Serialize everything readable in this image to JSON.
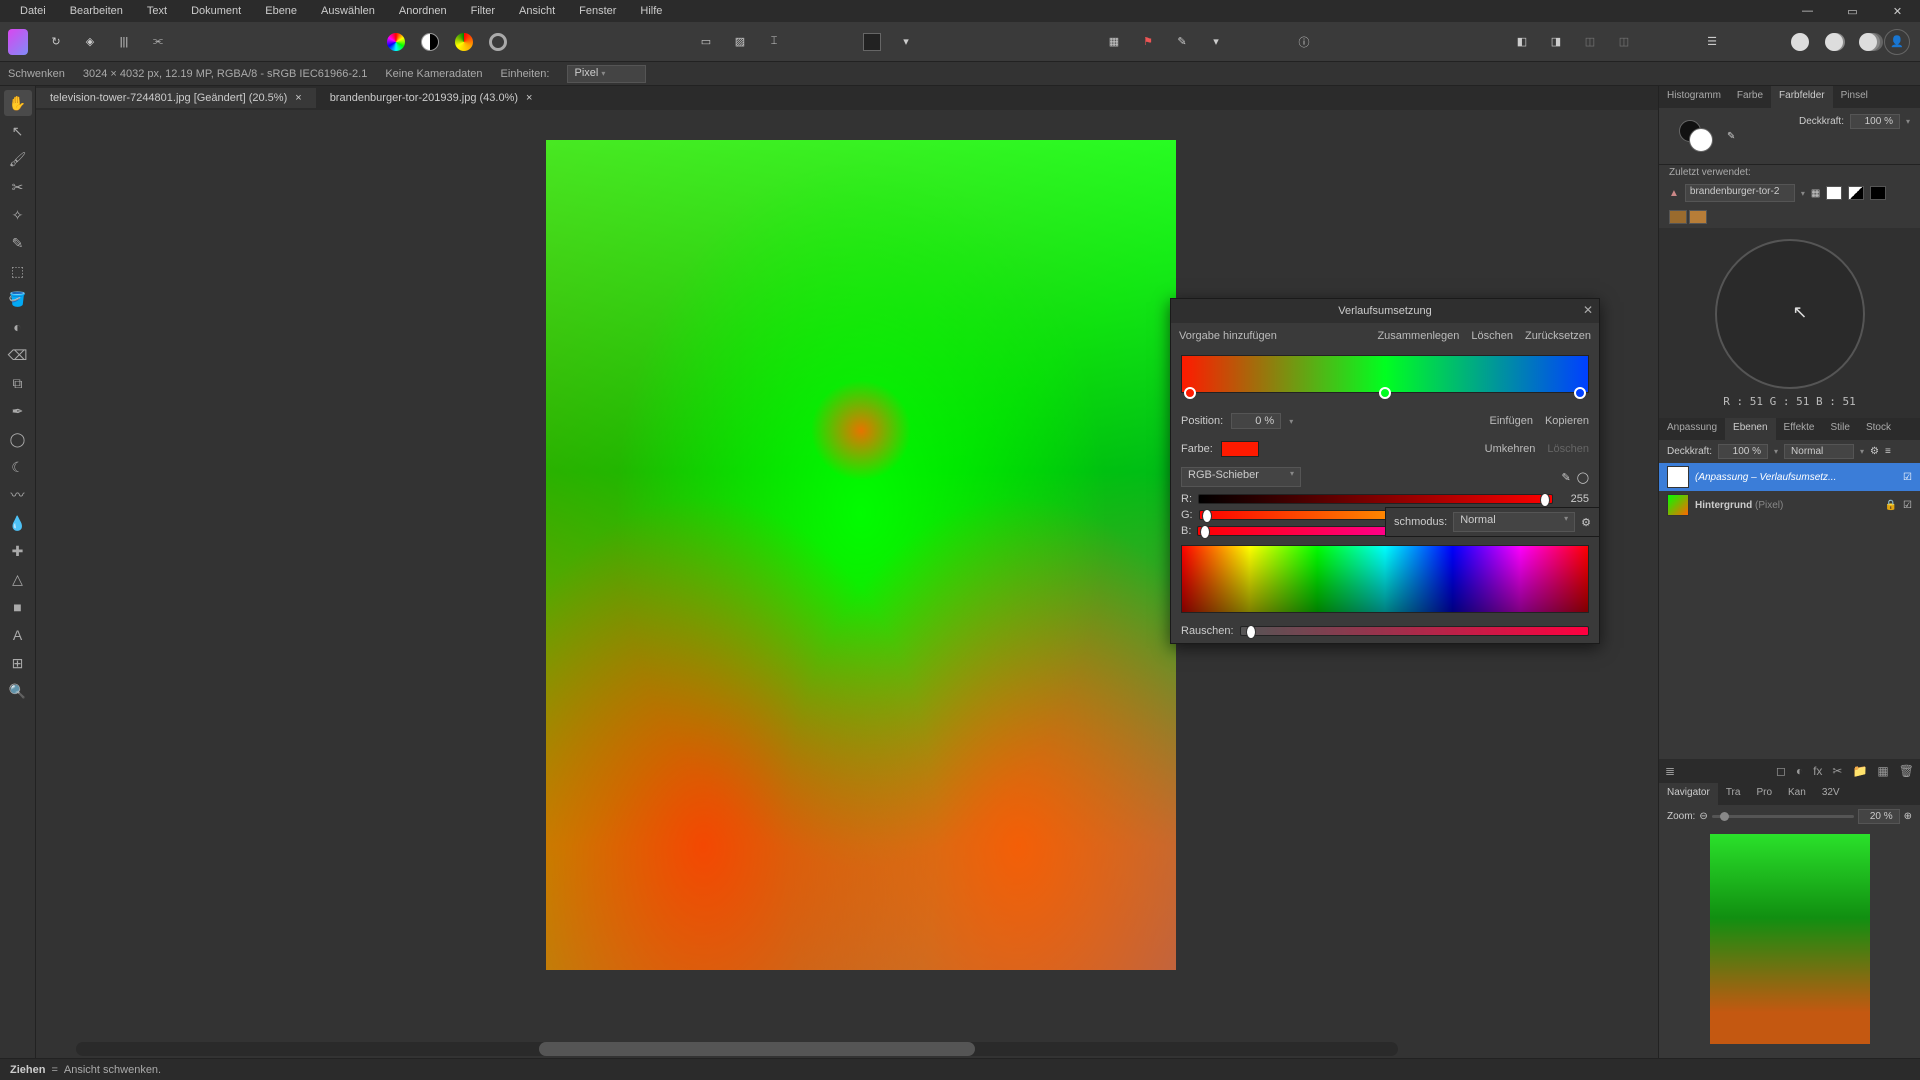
{
  "menus": [
    "Datei",
    "Bearbeiten",
    "Text",
    "Dokument",
    "Ebene",
    "Auswählen",
    "Anordnen",
    "Filter",
    "Ansicht",
    "Fenster",
    "Hilfe"
  ],
  "context": {
    "tool": "Schwenken",
    "doc_info": "3024 × 4032 px, 12.19 MP, RGBA/8 - sRGB IEC61966-2.1",
    "camera": "Keine Kameradaten",
    "units_label": "Einheiten:",
    "units_value": "Pixel"
  },
  "tabs": [
    {
      "label": "television-tower-7244801.jpg [Geändert] (20.5%)",
      "active": true
    },
    {
      "label": "brandenburger-tor-201939.jpg (43.0%)",
      "active": false
    }
  ],
  "right": {
    "panel1_tabs": [
      "Histogramm",
      "Farbe",
      "Farbfelder",
      "Pinsel"
    ],
    "panel1_active": "Farbfelder",
    "opacity_label": "Deckkraft:",
    "opacity_value": "100 %",
    "recent_label": "Zuletzt verwendet:",
    "recent_preset": "brandenburger-tor-2",
    "swatches": [
      "#9a6b2e",
      "#b77d38"
    ],
    "rgb_readout": "R : 51 G : 51 B : 51",
    "panel2_tabs": [
      "Anpassung",
      "Ebenen",
      "Effekte",
      "Stile",
      "Stock"
    ],
    "panel2_active": "Ebenen",
    "layer_opacity_label": "Deckkraft:",
    "layer_opacity_value": "100 %",
    "blend_mode": "Normal",
    "layers": [
      {
        "name": "(Anpassung – Verlaufsumsetz...",
        "selected": true
      },
      {
        "name_bold": "Hintergrund",
        "name_paren": "(Pixel)",
        "selected": false
      }
    ],
    "nav_tabs": [
      "Navigator",
      "Tra",
      "Pro",
      "Kan",
      "32V"
    ],
    "nav_active": "Navigator",
    "zoom_label": "Zoom:",
    "zoom_value": "20 %"
  },
  "dialog": {
    "title": "Verlaufsumsetzung",
    "add_preset": "Vorgabe hinzufügen",
    "merge": "Zusammenlegen",
    "delete": "Löschen",
    "reset": "Zurücksetzen",
    "stops": [
      {
        "pos": 0,
        "color": "#ff1a00"
      },
      {
        "pos": 50,
        "color": "#00ff20"
      },
      {
        "pos": 100,
        "color": "#0040ff"
      }
    ],
    "position_label": "Position:",
    "position_value": "0 %",
    "color_label": "Farbe:",
    "insert": "Einfügen",
    "copy": "Kopieren",
    "reverse": "Umkehren",
    "delete2": "Löschen",
    "model": "RGB-Schieber",
    "r_label": "R:",
    "r_val": "255",
    "g_label": "G:",
    "g_val": "0",
    "b_label": "B:",
    "b_val": "0",
    "noise_label": "Rauschen:"
  },
  "blend": {
    "label": "schmodus:",
    "value": "Normal"
  },
  "status": {
    "drag": "Ziehen",
    "sep": "=",
    "desc": "Ansicht schwenken."
  }
}
